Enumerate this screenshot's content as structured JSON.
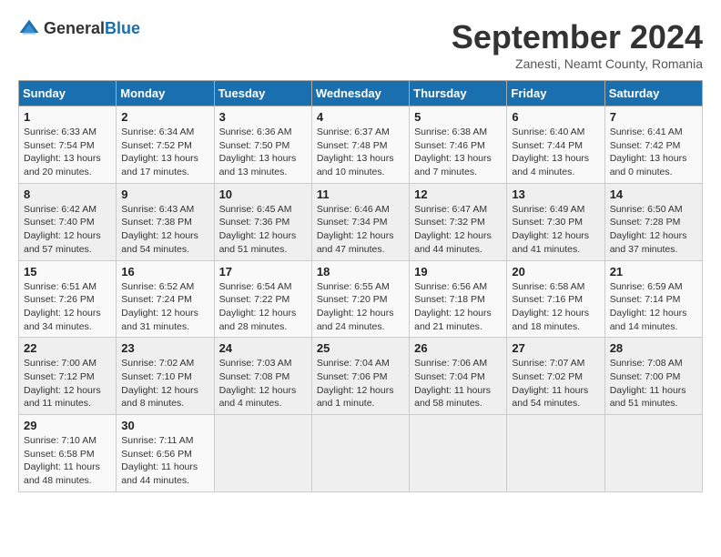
{
  "logo": {
    "general": "General",
    "blue": "Blue"
  },
  "title": "September 2024",
  "subtitle": "Zanesti, Neamt County, Romania",
  "days_of_week": [
    "Sunday",
    "Monday",
    "Tuesday",
    "Wednesday",
    "Thursday",
    "Friday",
    "Saturday"
  ],
  "weeks": [
    [
      {
        "day": "1",
        "sunrise": "6:33 AM",
        "sunset": "7:54 PM",
        "daylight": "13 hours and 20 minutes"
      },
      {
        "day": "2",
        "sunrise": "6:34 AM",
        "sunset": "7:52 PM",
        "daylight": "13 hours and 17 minutes"
      },
      {
        "day": "3",
        "sunrise": "6:36 AM",
        "sunset": "7:50 PM",
        "daylight": "13 hours and 13 minutes"
      },
      {
        "day": "4",
        "sunrise": "6:37 AM",
        "sunset": "7:48 PM",
        "daylight": "13 hours and 10 minutes"
      },
      {
        "day": "5",
        "sunrise": "6:38 AM",
        "sunset": "7:46 PM",
        "daylight": "13 hours and 7 minutes"
      },
      {
        "day": "6",
        "sunrise": "6:40 AM",
        "sunset": "7:44 PM",
        "daylight": "13 hours and 4 minutes"
      },
      {
        "day": "7",
        "sunrise": "6:41 AM",
        "sunset": "7:42 PM",
        "daylight": "13 hours and 0 minutes"
      }
    ],
    [
      {
        "day": "8",
        "sunrise": "6:42 AM",
        "sunset": "7:40 PM",
        "daylight": "12 hours and 57 minutes"
      },
      {
        "day": "9",
        "sunrise": "6:43 AM",
        "sunset": "7:38 PM",
        "daylight": "12 hours and 54 minutes"
      },
      {
        "day": "10",
        "sunrise": "6:45 AM",
        "sunset": "7:36 PM",
        "daylight": "12 hours and 51 minutes"
      },
      {
        "day": "11",
        "sunrise": "6:46 AM",
        "sunset": "7:34 PM",
        "daylight": "12 hours and 47 minutes"
      },
      {
        "day": "12",
        "sunrise": "6:47 AM",
        "sunset": "7:32 PM",
        "daylight": "12 hours and 44 minutes"
      },
      {
        "day": "13",
        "sunrise": "6:49 AM",
        "sunset": "7:30 PM",
        "daylight": "12 hours and 41 minutes"
      },
      {
        "day": "14",
        "sunrise": "6:50 AM",
        "sunset": "7:28 PM",
        "daylight": "12 hours and 37 minutes"
      }
    ],
    [
      {
        "day": "15",
        "sunrise": "6:51 AM",
        "sunset": "7:26 PM",
        "daylight": "12 hours and 34 minutes"
      },
      {
        "day": "16",
        "sunrise": "6:52 AM",
        "sunset": "7:24 PM",
        "daylight": "12 hours and 31 minutes"
      },
      {
        "day": "17",
        "sunrise": "6:54 AM",
        "sunset": "7:22 PM",
        "daylight": "12 hours and 28 minutes"
      },
      {
        "day": "18",
        "sunrise": "6:55 AM",
        "sunset": "7:20 PM",
        "daylight": "12 hours and 24 minutes"
      },
      {
        "day": "19",
        "sunrise": "6:56 AM",
        "sunset": "7:18 PM",
        "daylight": "12 hours and 21 minutes"
      },
      {
        "day": "20",
        "sunrise": "6:58 AM",
        "sunset": "7:16 PM",
        "daylight": "12 hours and 18 minutes"
      },
      {
        "day": "21",
        "sunrise": "6:59 AM",
        "sunset": "7:14 PM",
        "daylight": "12 hours and 14 minutes"
      }
    ],
    [
      {
        "day": "22",
        "sunrise": "7:00 AM",
        "sunset": "7:12 PM",
        "daylight": "12 hours and 11 minutes"
      },
      {
        "day": "23",
        "sunrise": "7:02 AM",
        "sunset": "7:10 PM",
        "daylight": "12 hours and 8 minutes"
      },
      {
        "day": "24",
        "sunrise": "7:03 AM",
        "sunset": "7:08 PM",
        "daylight": "12 hours and 4 minutes"
      },
      {
        "day": "25",
        "sunrise": "7:04 AM",
        "sunset": "7:06 PM",
        "daylight": "12 hours and 1 minute"
      },
      {
        "day": "26",
        "sunrise": "7:06 AM",
        "sunset": "7:04 PM",
        "daylight": "11 hours and 58 minutes"
      },
      {
        "day": "27",
        "sunrise": "7:07 AM",
        "sunset": "7:02 PM",
        "daylight": "11 hours and 54 minutes"
      },
      {
        "day": "28",
        "sunrise": "7:08 AM",
        "sunset": "7:00 PM",
        "daylight": "11 hours and 51 minutes"
      }
    ],
    [
      {
        "day": "29",
        "sunrise": "7:10 AM",
        "sunset": "6:58 PM",
        "daylight": "11 hours and 48 minutes"
      },
      {
        "day": "30",
        "sunrise": "7:11 AM",
        "sunset": "6:56 PM",
        "daylight": "11 hours and 44 minutes"
      },
      null,
      null,
      null,
      null,
      null
    ]
  ]
}
